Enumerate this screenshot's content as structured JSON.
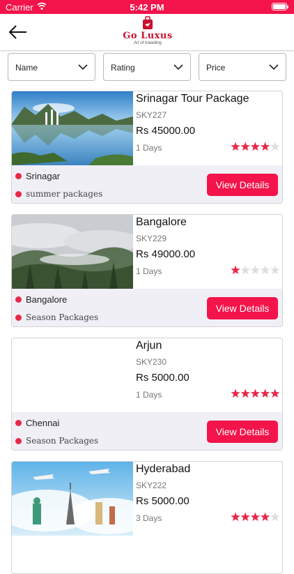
{
  "status_bar": {
    "carrier": "Carrier",
    "time": "5:42 PM"
  },
  "header": {
    "logo_name": "Go Luxus",
    "logo_tagline": "Art of travelling"
  },
  "filters": [
    {
      "label": "Name"
    },
    {
      "label": "Rating"
    },
    {
      "label": "Price"
    }
  ],
  "view_details_label": "View Details",
  "star_color": "#e8284a",
  "packages": [
    {
      "title": "Srinagar Tour Package",
      "code": "SKY227",
      "price": "Rs 45000.00",
      "days": "1 Days",
      "rating": 4,
      "city": "Srinagar",
      "category": "summer packages",
      "image": "lake-landscape"
    },
    {
      "title": "Bangalore",
      "code": "SKY229",
      "price": "Rs 49000.00",
      "days": "1 Days",
      "rating": 1,
      "city": "Bangalore",
      "category": "Season Packages",
      "image": "misty-forest"
    },
    {
      "title": "Arjun",
      "code": "SKY230",
      "price": "Rs 5000.00",
      "days": "1 Days",
      "rating": 5,
      "city": "Chennai",
      "category": "Season Packages",
      "image": "blank"
    },
    {
      "title": "Hyderabad",
      "code": "SKY222",
      "price": "Rs 5000.00",
      "days": "3 Days",
      "rating": 4,
      "city": "",
      "category": "",
      "image": "world-landmarks"
    }
  ]
}
